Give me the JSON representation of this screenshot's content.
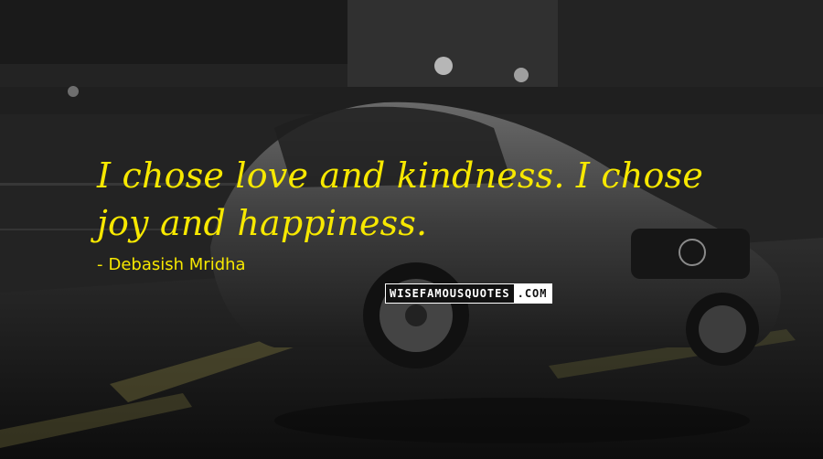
{
  "quote": {
    "text": "I chose love and kindness. I chose joy and happiness.",
    "author": "Debasish Mridha",
    "dash": "-"
  },
  "watermark": {
    "main": "WISEFAMOUSQUOTES",
    "suffix": ".COM"
  },
  "colors": {
    "quote_text": "#f7e800",
    "background": "#2a2a2a"
  }
}
